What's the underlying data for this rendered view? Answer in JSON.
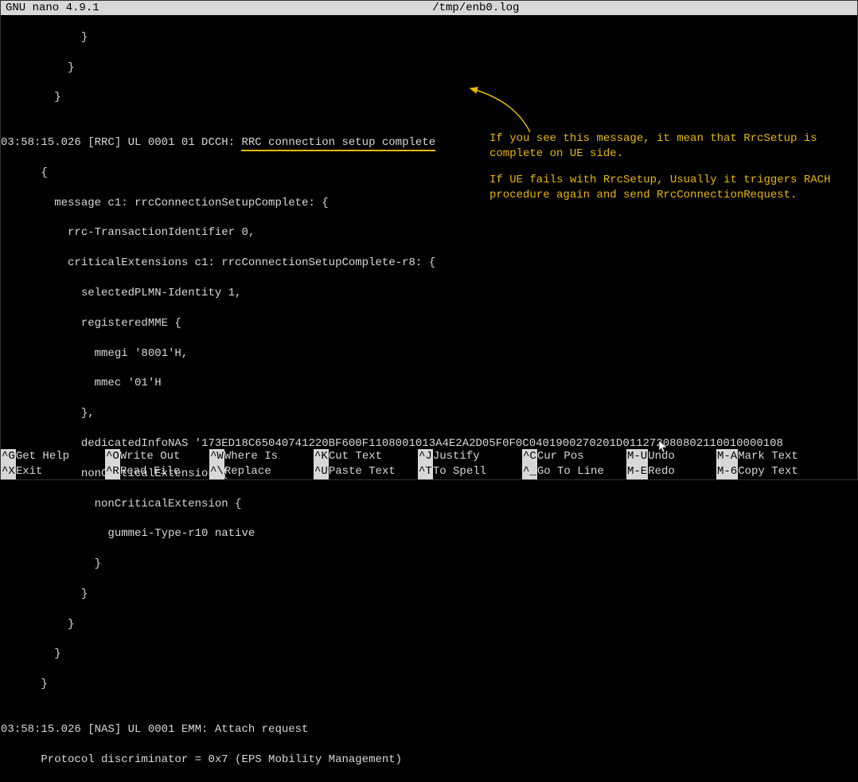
{
  "header": {
    "app": "  GNU nano 4.9.1",
    "filename": "/tmp/enb0.log"
  },
  "code": {
    "l01": "            }",
    "l02": "          }",
    "l03": "        }",
    "l04": "",
    "l05a": "03:58:15.026 [RRC] UL 0001 01 DCCH: ",
    "l05b": "RRC connection setup complete",
    "l06": "      {",
    "l07": "        message c1: rrcConnectionSetupComplete: {",
    "l08": "          rrc-TransactionIdentifier 0,",
    "l09": "          criticalExtensions c1: rrcConnectionSetupComplete-r8: {",
    "l10": "            selectedPLMN-Identity 1,",
    "l11": "            registeredMME {",
    "l12": "              mmegi '8001'H,",
    "l13": "              mmec '01'H",
    "l14": "            },",
    "l15": "            dedicatedInfoNAS '173ED18C65040741220BF600F1108001013A4E2A2D05F0F0C0401900270201D011272080802110010000108",
    "l16": "            nonCriticalExtension {",
    "l17": "              nonCriticalExtension {",
    "l18": "                gummei-Type-r10 native",
    "l19": "              }",
    "l20": "            }",
    "l21": "          }",
    "l22": "        }",
    "l23": "      }",
    "l24": "",
    "l25": "03:58:15.026 [NAS] UL 0001 EMM: Attach request",
    "l26": "      Protocol discriminator = 0x7 (EPS Mobility Management)"
  },
  "annotation": {
    "p1": "If you see this message, it mean that RrcSetup is complete on UE side.",
    "p2": "If UE fails with RrcSetup, Usually it triggers RACH procedure again and send RrcConnectionRequest."
  },
  "footer": {
    "row1": [
      {
        "k": "^G",
        "l": " Get Help"
      },
      {
        "k": "^O",
        "l": " Write Out"
      },
      {
        "k": "^W",
        "l": " Where Is"
      },
      {
        "k": "^K",
        "l": " Cut Text"
      },
      {
        "k": "^J",
        "l": " Justify"
      },
      {
        "k": "^C",
        "l": " Cur Pos"
      },
      {
        "k": "M-U",
        "l": " Undo"
      },
      {
        "k": "M-A",
        "l": " Mark Text"
      }
    ],
    "row2": [
      {
        "k": "^X",
        "l": " Exit"
      },
      {
        "k": "^R",
        "l": " Read File"
      },
      {
        "k": "^\\",
        "l": " Replace"
      },
      {
        "k": "^U",
        "l": " Paste Text"
      },
      {
        "k": "^T",
        "l": " To Spell"
      },
      {
        "k": "^_",
        "l": " Go To Line"
      },
      {
        "k": "M-E",
        "l": " Redo"
      },
      {
        "k": "M-6",
        "l": " Copy Text"
      }
    ]
  }
}
